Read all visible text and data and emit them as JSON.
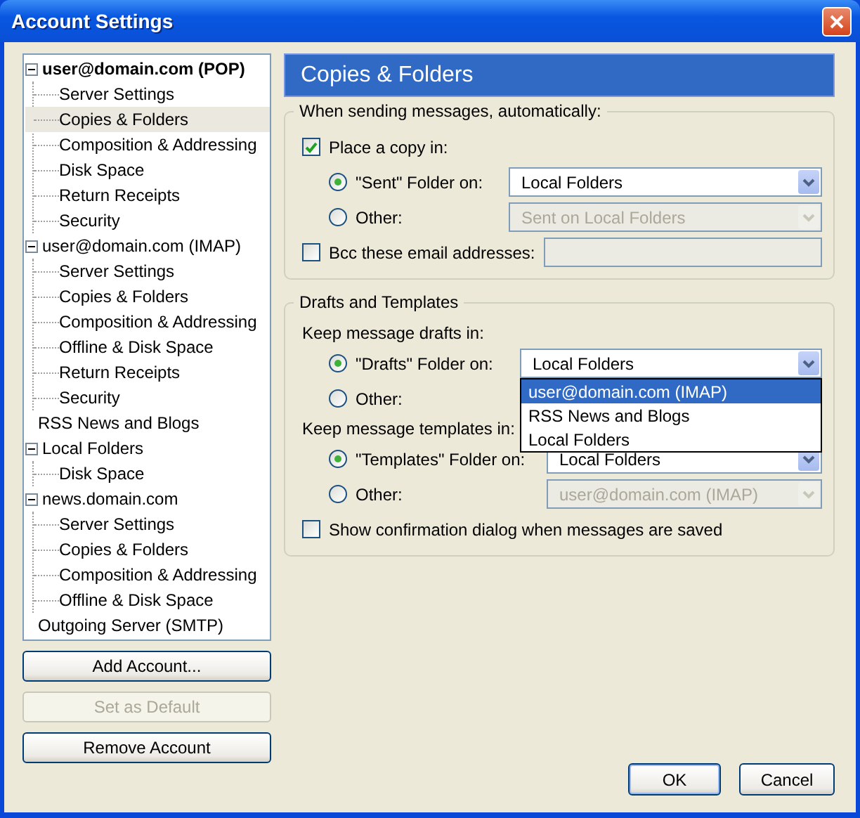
{
  "window": {
    "title": "Account Settings"
  },
  "tree": [
    {
      "label": "user@domain.com  (POP)",
      "default": true,
      "expanded": true,
      "selected": false,
      "children": [
        {
          "label": "Server Settings",
          "selected": false
        },
        {
          "label": "Copies & Folders",
          "selected": true
        },
        {
          "label": "Composition & Addressing",
          "selected": false
        },
        {
          "label": "Disk Space",
          "selected": false
        },
        {
          "label": "Return Receipts",
          "selected": false
        },
        {
          "label": "Security",
          "selected": false
        }
      ]
    },
    {
      "label": "user@domain.com  (IMAP)",
      "default": false,
      "expanded": true,
      "selected": false,
      "children": [
        {
          "label": "Server Settings",
          "selected": false
        },
        {
          "label": "Copies & Folders",
          "selected": false
        },
        {
          "label": "Composition & Addressing",
          "selected": false
        },
        {
          "label": "Offline & Disk Space",
          "selected": false
        },
        {
          "label": "Return Receipts",
          "selected": false
        },
        {
          "label": "Security",
          "selected": false
        }
      ]
    },
    {
      "label": "RSS News and Blogs",
      "default": false,
      "selected": false
    },
    {
      "label": "Local Folders",
      "default": false,
      "expanded": true,
      "selected": false,
      "children": [
        {
          "label": "Disk Space",
          "selected": false
        }
      ]
    },
    {
      "label": "news.domain.com",
      "default": false,
      "expanded": true,
      "selected": false,
      "children": [
        {
          "label": "Server Settings",
          "selected": false
        },
        {
          "label": "Copies & Folders",
          "selected": false
        },
        {
          "label": "Composition & Addressing",
          "selected": false
        },
        {
          "label": "Offline & Disk Space",
          "selected": false
        }
      ]
    },
    {
      "label": "Outgoing Server (SMTP)",
      "default": false,
      "selected": false
    }
  ],
  "account_buttons": [
    {
      "label": "Add Account...",
      "disabled": false
    },
    {
      "label": "Set as Default",
      "disabled": true
    },
    {
      "label": "Remove Account",
      "disabled": false
    }
  ],
  "panel_title": "Copies & Folders",
  "sending": {
    "title": "When sending messages, automatically:",
    "place_copy": {
      "label": "Place a copy in:",
      "checked": true
    },
    "options": [
      {
        "label": "\"Sent\" Folder on:",
        "selected": true,
        "dropdown": {
          "value": "Local Folders",
          "disabled": false
        }
      },
      {
        "label": "Other:",
        "selected": false,
        "dropdown": {
          "value": "Sent on Local Folders",
          "disabled": true
        }
      }
    ],
    "bcc": {
      "label": "Bcc these email addresses:",
      "checked": false,
      "field_disabled": true
    }
  },
  "drafts": {
    "title": "Drafts and Templates",
    "drafts_label": "Keep message drafts in:",
    "drafts_options": [
      {
        "label": "\"Drafts\" Folder on:",
        "selected": true,
        "dropdown": {
          "value": "Local Folders",
          "disabled": false,
          "open": true
        }
      },
      {
        "label": "Other:",
        "selected": false
      }
    ],
    "popup": [
      {
        "label": "user@domain.com  (IMAP)",
        "selected": true
      },
      {
        "label": "RSS News and Blogs",
        "selected": false
      },
      {
        "label": "Local Folders",
        "selected": false
      }
    ],
    "templates_label": "Keep message templates in:",
    "templates_options": [
      {
        "label": "\"Templates\" Folder on:",
        "selected": true,
        "dropdown": {
          "value": "Local Folders",
          "disabled": false
        }
      },
      {
        "label": "Other:",
        "selected": false,
        "dropdown": {
          "value": "user@domain.com  (IMAP)",
          "disabled": true
        }
      }
    ],
    "confirm": {
      "label": "Show confirmation dialog when messages are saved",
      "checked": false
    }
  },
  "footer_buttons": [
    "OK",
    "Cancel"
  ]
}
